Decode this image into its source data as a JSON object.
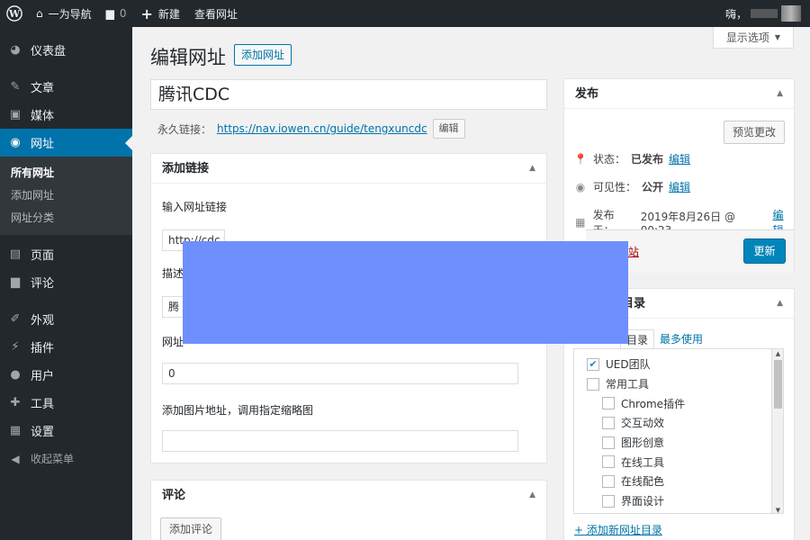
{
  "adminbar": {
    "site_name": "一为导航",
    "comments_count": "0",
    "new_label": "新建",
    "view_label": "查看网址",
    "greeting": "嗨，"
  },
  "sidebar": {
    "items": [
      {
        "label": "仪表盘",
        "icon": "dashboard-icon"
      },
      {
        "label": "文章",
        "icon": "pin-icon"
      },
      {
        "label": "媒体",
        "icon": "media-icon"
      },
      {
        "label": "网址",
        "icon": "globe-icon"
      },
      {
        "label": "页面",
        "icon": "page-icon"
      },
      {
        "label": "评论",
        "icon": "comment-icon"
      },
      {
        "label": "外观",
        "icon": "brush-icon"
      },
      {
        "label": "插件",
        "icon": "plug-icon"
      },
      {
        "label": "用户",
        "icon": "user-icon"
      },
      {
        "label": "工具",
        "icon": "wrench-icon"
      },
      {
        "label": "设置",
        "icon": "settings-icon"
      }
    ],
    "submenu": [
      "所有网址",
      "添加网址",
      "网址分类"
    ],
    "collapse_label": "收起菜单"
  },
  "screen_options": "显示选项",
  "page": {
    "title": "编辑网址",
    "add_new": "添加网址",
    "post_title": "腾讯CDC",
    "permalink_label": "永久链接：",
    "permalink_url": "https://nav.iowen.cn/guide/tengxuncdc",
    "permalink_edit": "编辑"
  },
  "link_box": {
    "title": "添加链接",
    "url_label": "输入网址链接",
    "url_value": "http://cdc.t",
    "desc_label": "描述",
    "desc_value": "腾",
    "order_label": "网址",
    "order_value": "0",
    "image_label": "添加图片地址，调用指定缩略图",
    "image_value": ""
  },
  "comments_box": {
    "title": "评论",
    "add_button": "添加评论"
  },
  "publish_box": {
    "title": "发布",
    "preview_button": "预览更改",
    "status_label": "状态：",
    "status_value": "已发布",
    "visibility_label": "可见性：",
    "visibility_value": "公开",
    "published_label": "发布于：",
    "published_value": "2019年8月26日 @ 00:23",
    "edit_link": "编辑",
    "delete_link": "站",
    "update_button": "更新"
  },
  "category_box": {
    "title": "目录",
    "tab_all": "目录",
    "tab_popular": "最多使用",
    "items": [
      {
        "label": "UED团队",
        "checked": true,
        "indent": 0
      },
      {
        "label": "常用工具",
        "checked": false,
        "indent": 0
      },
      {
        "label": "Chrome插件",
        "checked": false,
        "indent": 1
      },
      {
        "label": "交互动效",
        "checked": false,
        "indent": 1
      },
      {
        "label": "图形创意",
        "checked": false,
        "indent": 1
      },
      {
        "label": "在线工具",
        "checked": false,
        "indent": 1
      },
      {
        "label": "在线配色",
        "checked": false,
        "indent": 1
      },
      {
        "label": "界面设计",
        "checked": false,
        "indent": 1
      }
    ],
    "add_new": "+ 添加新网址目录"
  },
  "colors": {
    "admin_dark": "#23282d",
    "accent": "#0073aa",
    "button_primary": "#0085ba",
    "overlay": "#6f8fff"
  }
}
